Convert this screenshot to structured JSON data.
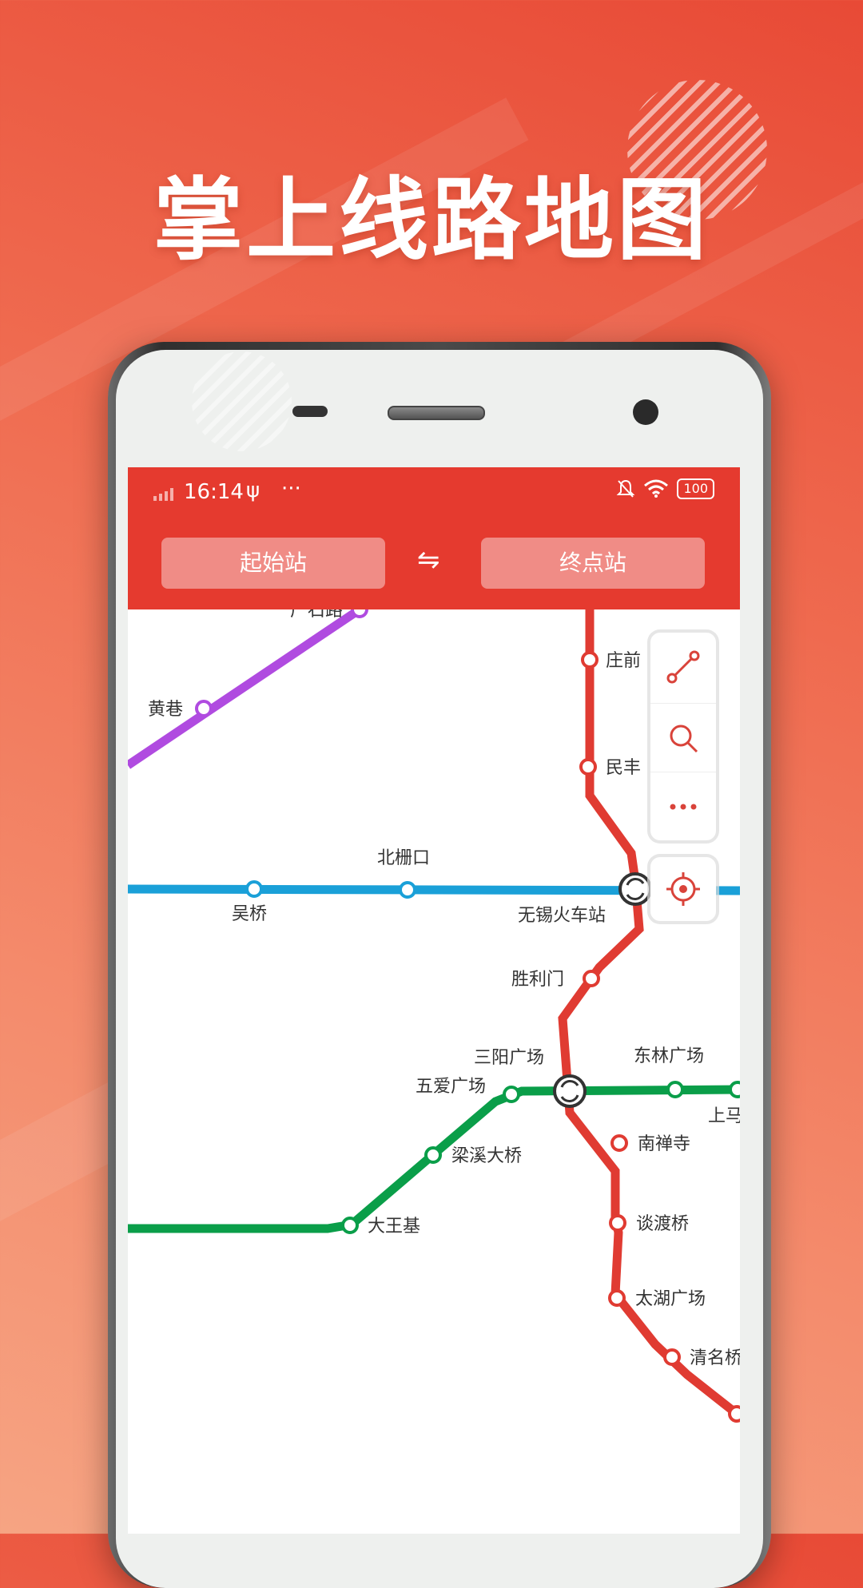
{
  "promo": {
    "headline": "掌上线路地图"
  },
  "status_bar": {
    "time": "16:14",
    "battery": "100"
  },
  "route_bar": {
    "start_placeholder": "起始站",
    "end_placeholder": "终点站",
    "swap_symbol": "⇋"
  },
  "map": {
    "stations": {
      "top_cut": "广石路",
      "huangxiang": "黄巷",
      "zhuangqian": "庄前",
      "minfeng": "民丰",
      "beishankou": "北栅口",
      "wuqiao": "吴桥",
      "wuxi_station": "无锡火车站",
      "shengli_men": "胜利门",
      "sanyang": "三阳广场",
      "donglin": "东林广场",
      "wuai": "五爱广场",
      "shangma": "上马墩",
      "liangxi": "梁溪大桥",
      "nanchan": "南禅寺",
      "dawangji": "大王基",
      "tandu": "谈渡桥",
      "taihu": "太湖广场",
      "qingming": "清名桥"
    },
    "line_colors": {
      "line1": "#e03b32",
      "line2": "#0a9e49",
      "line3": "#1aa0d8",
      "line4": "#b04be0"
    }
  },
  "tools": {
    "route_icon": "route-icon",
    "search_icon": "search-icon",
    "more_icon": "more-icon",
    "locate_icon": "locate-icon"
  }
}
